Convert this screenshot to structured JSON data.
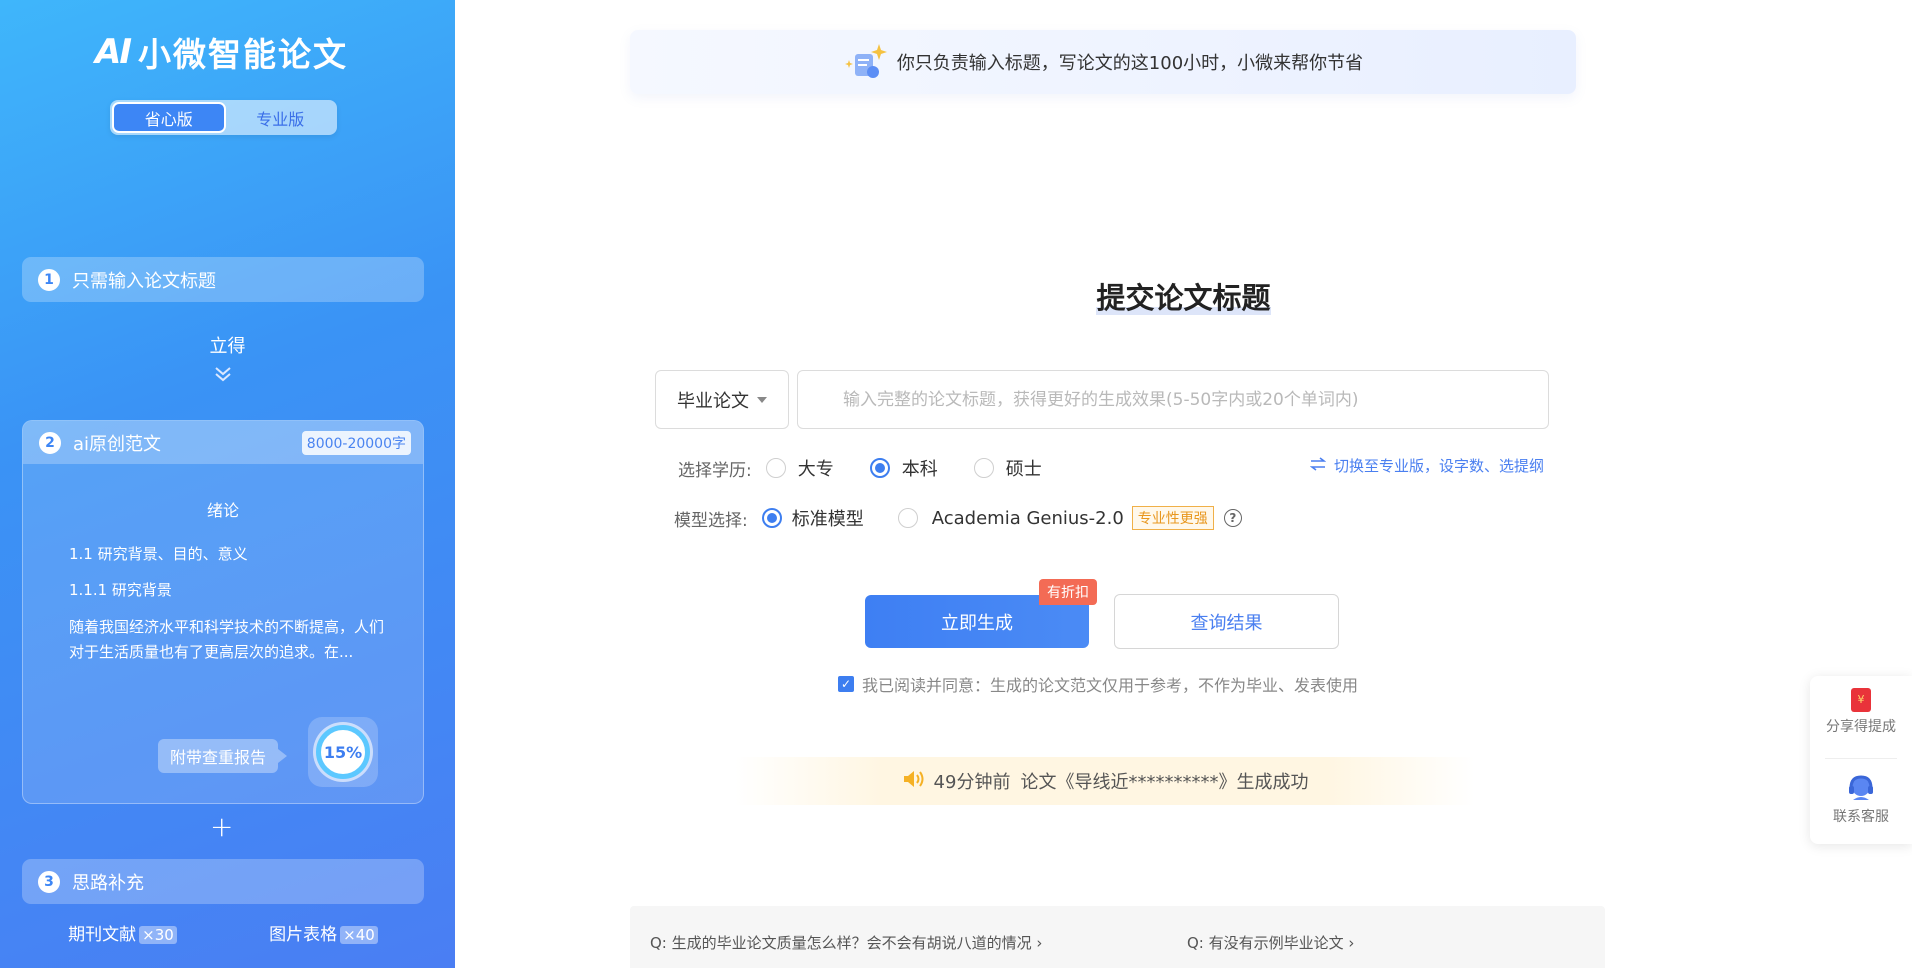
{
  "brand": {
    "logo_mark": "AI",
    "name": "小微智能论文"
  },
  "version_toggle": {
    "simple": "省心版",
    "pro": "专业版",
    "active": "simple"
  },
  "sidebar": {
    "step1": {
      "num": "1",
      "label": "只需输入论文标题"
    },
    "instant": "立得",
    "step2": {
      "num": "2",
      "label": "ai原创范文",
      "tag": "8000-20000字",
      "sample_title": "绪论",
      "line1": "1.1 研究背景、目的、意义",
      "line2": "1.1.1 研究背景",
      "paragraph": "随着我国经济水平和科学技术的不断提高，人们对于生活质量也有了更高层次的追求。在...",
      "report_label": "附带查重报告",
      "report_percent": "15%"
    },
    "plus": "+",
    "step3": {
      "num": "3",
      "label": "思路补充",
      "journals_label": "期刊文献",
      "journals_count": "×30",
      "figures_label": "图片表格",
      "figures_count": "×40"
    }
  },
  "banner": {
    "text": "你只负责输入标题，写论文的这100小时，小微来帮你节省"
  },
  "main": {
    "title": "提交论文标题",
    "type_select": "毕业论文",
    "title_input_placeholder": "输入完整的论文标题，获得更好的生成效果(5-50字内或20个单词内)",
    "degree_label": "选择学历:",
    "degree_options": [
      "大专",
      "本科",
      "硕士"
    ],
    "degree_selected": "本科",
    "switch_link": "切换至专业版，设字数、选提纲",
    "model_label": "模型选择:",
    "model_standard": "标准模型",
    "model_pro": "Academia Genius-2.0",
    "model_pro_badge": "专业性更强",
    "help_icon": "?",
    "generate_button": "立即生成",
    "discount_badge": "有折扣",
    "query_button": "查询结果",
    "agree_text": "我已阅读并同意：生成的论文范文仅用于参考，不作为毕业、发表使用",
    "notice_time": "49分钟前",
    "notice_text": "论文《导线近**********》生成成功"
  },
  "faq": {
    "q1": "Q:  生成的毕业论文质量怎么样？会不会有胡说八道的情况",
    "q2": "Q:  有没有示例毕业论文"
  },
  "float_panel": {
    "share": "分享得提成",
    "support": "联系客服"
  },
  "colors": {
    "primary": "#3d7ef0",
    "sidebar_top": "#3fb6fb",
    "sidebar_bottom": "#4a7ef3",
    "discount": "#f36b55",
    "badge_orange": "#e8971f"
  }
}
